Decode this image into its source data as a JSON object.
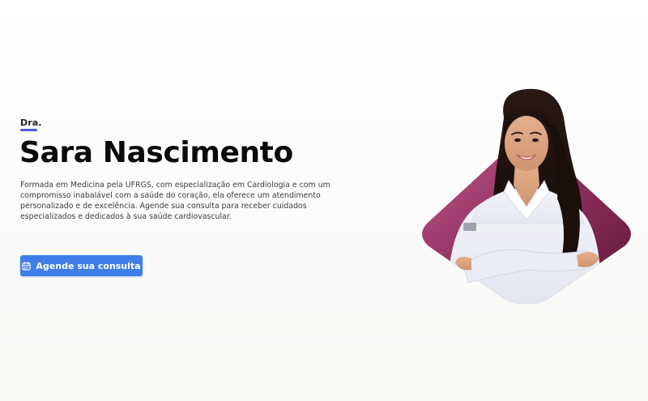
{
  "hero": {
    "eyebrow": "Dra.",
    "name": "Sara Nascimento",
    "description": "Formada em Medicina pela UFRGS, com especialização em Cardiologia e com um compromisso inabalável com a saúde do coração, ela oferece um atendimento personalizado e de excelência. Agende sua consulta para receber cuidados especializados e dedicados à sua saúde cardiovascular.",
    "cta_label": "Agende sua consulta",
    "cta_icon": "calendar-icon"
  },
  "colors": {
    "accent": "#3f7ee8",
    "underline": "#4f5bd5",
    "shape_gradient_start": "#c25a8f",
    "shape_gradient_end": "#6b1d3f",
    "coat": "#eef0f6"
  }
}
